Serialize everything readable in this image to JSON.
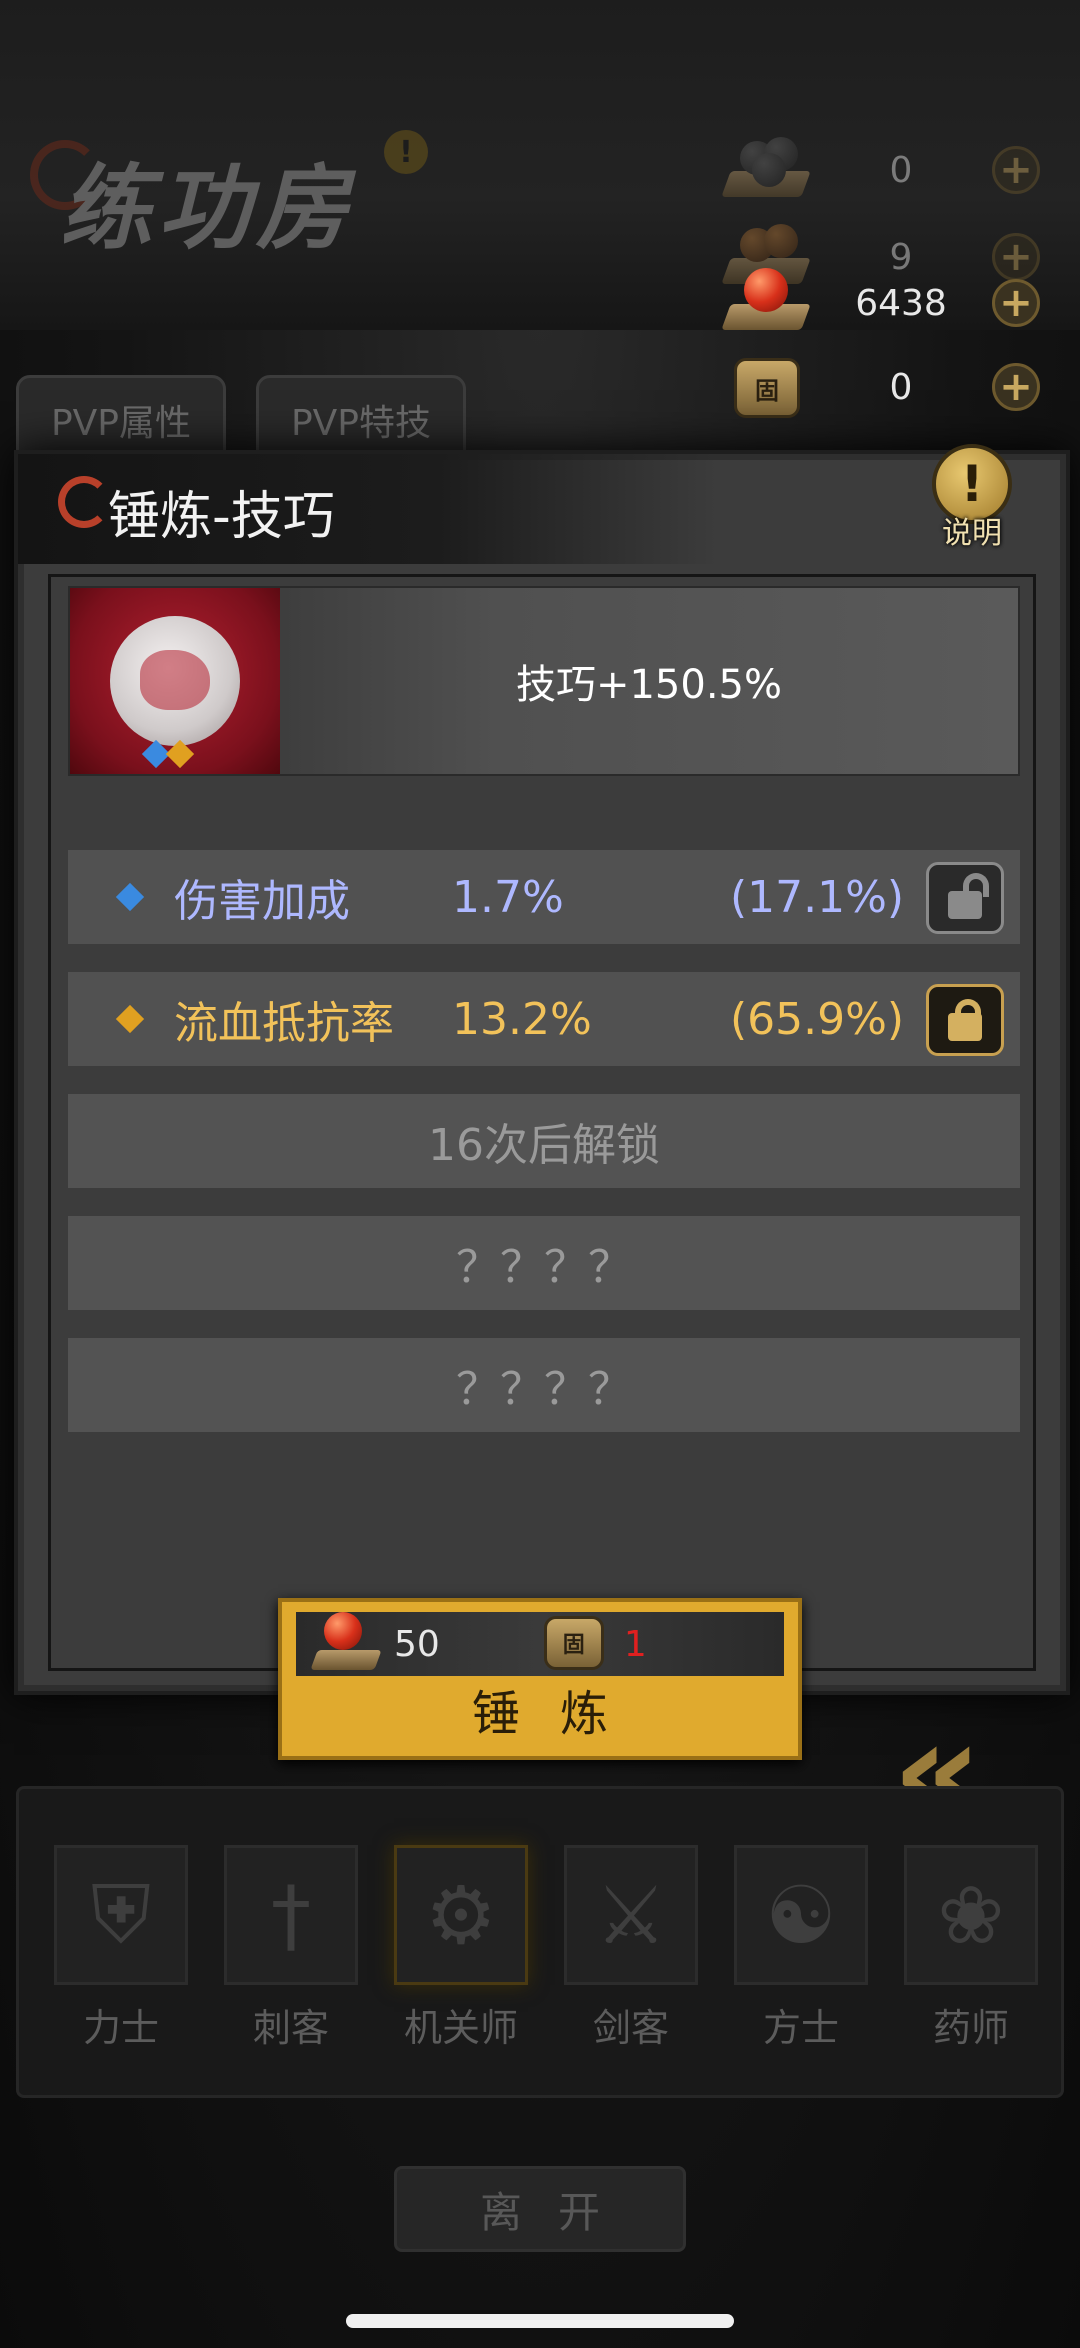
{
  "header": {
    "hall_title": "练功房",
    "alert_icon": "!"
  },
  "currencies": [
    {
      "icon": "dark-pellet-icon",
      "value": "0",
      "dim": true
    },
    {
      "icon": "brown-pellet-icon",
      "value": "9",
      "dim": true
    },
    {
      "icon": "red-orb-icon",
      "value": "6438",
      "dim": false
    },
    {
      "icon": "medal-icon",
      "value": "0",
      "dim": false,
      "medal_char": "固"
    }
  ],
  "tabs": [
    "PVP属性",
    "PVP特技"
  ],
  "panel": {
    "title": "锤炼-技巧",
    "help_label": "说明",
    "help_glyph": "!",
    "skill_effect": "技巧+150.5%",
    "attributes": [
      {
        "name": "伤害加成",
        "value": "1.7%",
        "max": "(17.1%)",
        "color": "#aeb8ff",
        "gem": "#3a8ae0",
        "locked": false
      },
      {
        "name": "流血抵抗率",
        "value": "13.2%",
        "max": "(65.9%)",
        "color": "#f2c25a",
        "gem": "#e0a020",
        "locked": true
      }
    ],
    "unlock_text": "16次后解锁",
    "unknown_rows": [
      "？？？？",
      "？？？？"
    ]
  },
  "forge": {
    "cost_orb": "50",
    "cost_medal": "1",
    "cost_medal_color": "#e02020",
    "medal_char": "固",
    "label": "锤炼"
  },
  "classes": [
    "力士",
    "刺客",
    "机关师",
    "剑客",
    "方士",
    "药师"
  ],
  "leave_label": "离开",
  "colors": {
    "accent_gold": "#e0aa2e",
    "panel_bg": "#3c3c3c"
  }
}
